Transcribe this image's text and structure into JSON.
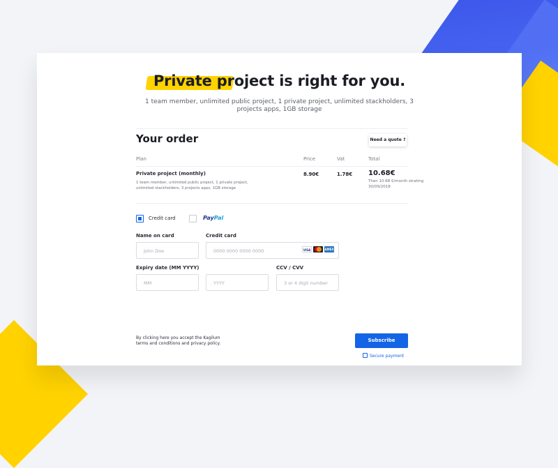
{
  "header": {
    "headline_highlight": "Private project",
    "headline_rest": " is right for you.",
    "subtitle": "1 team member, unlimited public project, 1 private project, unlimited stackholders, 3 projects apps, 1GB storage"
  },
  "order": {
    "title": "Your order",
    "quote_button": "Need a quote ?",
    "columns": {
      "plan": "Plan",
      "price": "Price",
      "vat": "Vat",
      "total": "Total"
    },
    "row": {
      "plan_name": "Private project (monthly)",
      "plan_desc": "1 team member, unlimited public project, 1 private project, unlimited stackholders, 3 projects apps, 1GB storage",
      "price": "8.90€",
      "vat": "1.78€",
      "total": "10.68€",
      "total_note": "Then 10.68 €/month strating 30/09/2018"
    }
  },
  "payment": {
    "credit_card_label": "Credit card",
    "credit_card_selected": true,
    "paypal_label_a": "Pay",
    "paypal_label_b": "Pal",
    "paypal_selected": false,
    "card_logos": [
      "VISA",
      "mastercard",
      "AMEX"
    ]
  },
  "form": {
    "name_label": "Name on card",
    "name_placeholder": "John Doe",
    "card_label": "Credit card",
    "card_placeholder": "0000 0000 0000 0000",
    "expiry_label": "Expiry date (MM YYYY)",
    "month_placeholder": "MM",
    "year_placeholder": "YYYY",
    "ccv_label": "CCV / CVV",
    "ccv_placeholder": "3 or 4 digit number"
  },
  "footer": {
    "terms": "By clicking here you accept the Kagilum terms and conditions and privacy policy.",
    "subscribe": "Subscribe",
    "secure": "Secure payment"
  },
  "colors": {
    "accent": "#1464e6",
    "highlight": "#ffd200",
    "deco_blue": "#2d46e6"
  }
}
